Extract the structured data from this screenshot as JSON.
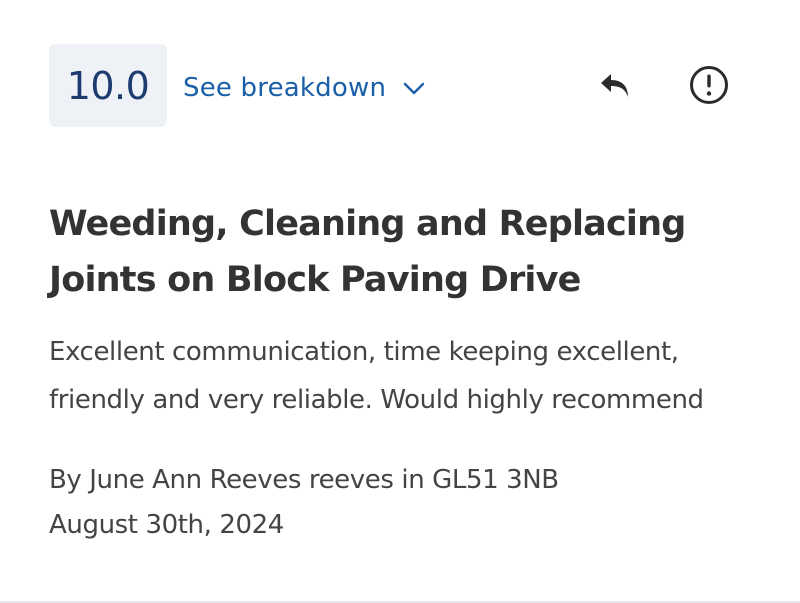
{
  "review": {
    "score": "10.0",
    "breakdown_label": "See breakdown",
    "title": "Weeding, Cleaning and Replacing Joints on Block Paving Drive",
    "body": "Excellent communication, time keeping excellent, friendly and very reliable. Would highly recommend",
    "author_line": "By June Ann Reeves reeves in GL51 3NB",
    "date": "August 30th, 2024"
  },
  "icons": {
    "breakdown": "chevron-down-icon",
    "reply": "reply-arrow-icon",
    "report": "exclamation-circle-icon"
  },
  "colors": {
    "score_bg": "#eef2f6",
    "score_text": "#1d3b6f",
    "link": "#1a5fa8",
    "title_text": "#333333",
    "body_text": "#444444"
  }
}
